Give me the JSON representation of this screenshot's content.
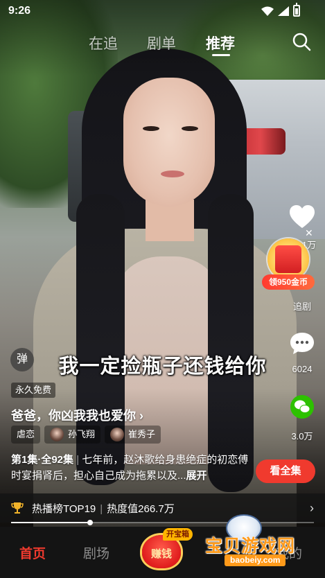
{
  "status_bar": {
    "time": "9:26"
  },
  "top_tabs": [
    {
      "label": "在追",
      "active": false
    },
    {
      "label": "剧单",
      "active": false
    },
    {
      "label": "推荐",
      "active": true
    }
  ],
  "right_rail": {
    "like_count": "1万",
    "follow_label": "追剧",
    "comment_count": "6024",
    "share_count": "3.0万",
    "coin_reward_label": "领950金币"
  },
  "danmu_label": "弹",
  "subtitle": "我一定捡瓶子还钱给你",
  "free_tag": "永久免费",
  "drama": {
    "title": "爸爸，你凶我我也爱你",
    "tags": [
      "虐恋"
    ],
    "actors": [
      "孙飞翔",
      "崔秀子"
    ],
    "episode_info": "第1集·全92集",
    "description": "七年前，赵沐歌给身患绝症的初恋傅时宴捐肾后，担心自己成为拖累以及...",
    "expand_label": "展开",
    "watch_all_label": "看全集"
  },
  "ranking": {
    "rank_label": "热播榜TOP19",
    "heat_label": "热度值266.7万"
  },
  "playback": {
    "progress": 0.26
  },
  "bottom_nav": {
    "items": [
      {
        "label": "首页",
        "active": true
      },
      {
        "label": "剧场",
        "active": false
      }
    ],
    "earn_label": "赚钱",
    "earn_badge": "开宝箱",
    "partial_label": "我的"
  },
  "watermark": {
    "title": "宝贝游戏网",
    "url": "baobeiy.com"
  },
  "colors": {
    "accent": "#f03a2e",
    "nav_bg": "#141414",
    "coin_gold": "#ffcf5a"
  }
}
